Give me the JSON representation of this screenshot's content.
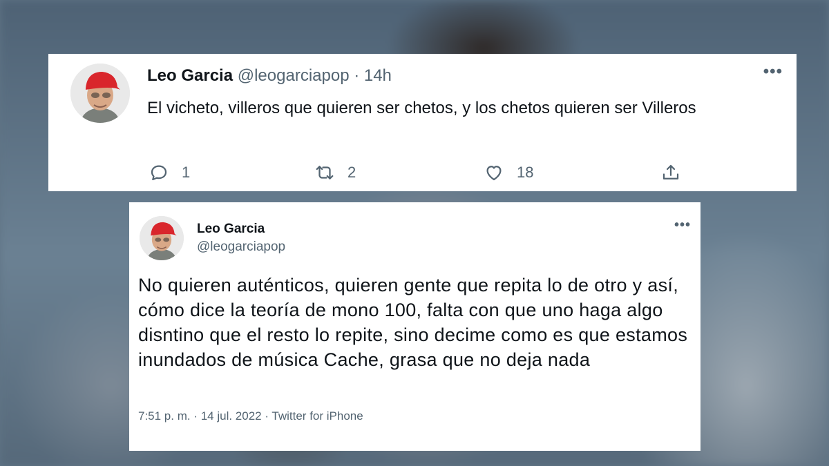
{
  "tweet1": {
    "name": "Leo Garcia",
    "meta": "@leogarciapop · 14h",
    "text": "El vicheto, villeros que quieren ser chetos, y los chetos quieren ser Villeros",
    "replies": "1",
    "retweets": "2",
    "likes": "18",
    "more": "•••"
  },
  "tweet2": {
    "name": "Leo Garcia",
    "handle": "@leogarciapop",
    "text": "No quieren auténticos, quieren gente que repita lo de otro y así, cómo dice la teoría de mono 100, falta con que uno haga algo disntino que el resto lo repite, sino decime como es que estamos inundados de música Cache, grasa que no deja nada",
    "footer": "7:51 p. m. · 14 jul. 2022 · Twitter for iPhone",
    "more": "•••"
  },
  "colors": {
    "text": "#0f1419",
    "secondary": "#536471",
    "cap": "#d9262c"
  },
  "icons": [
    "reply-icon",
    "retweet-icon",
    "like-icon",
    "share-icon",
    "more-icon"
  ]
}
